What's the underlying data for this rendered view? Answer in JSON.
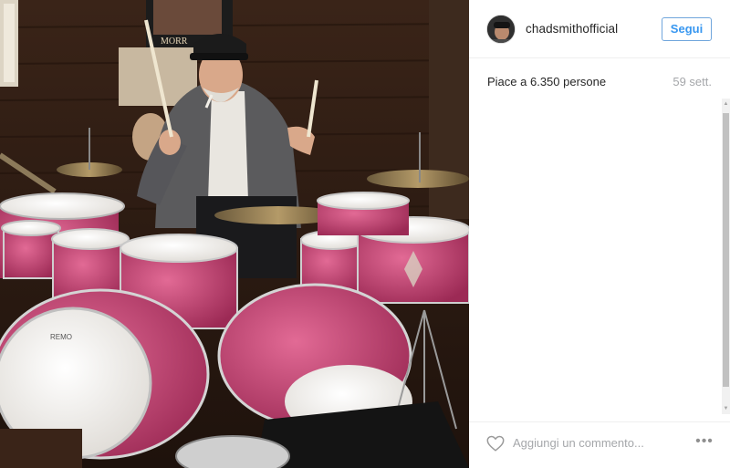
{
  "post": {
    "image_description_icon": "photo",
    "poster_text": "MORR"
  },
  "header": {
    "username": "chadsmithofficial",
    "follow_label": "Segui",
    "avatar_icon": "avatar-photo"
  },
  "meta": {
    "likes_text": "Piace a 6.350 persone",
    "time_text": "59 sett."
  },
  "footer": {
    "comment_placeholder": "Aggiungi un commento...",
    "more_label": "•••",
    "heart_icon": "heart-outline-icon"
  },
  "colors": {
    "follow_blue": "#3897f0",
    "muted_gray": "#a5a7aa"
  }
}
